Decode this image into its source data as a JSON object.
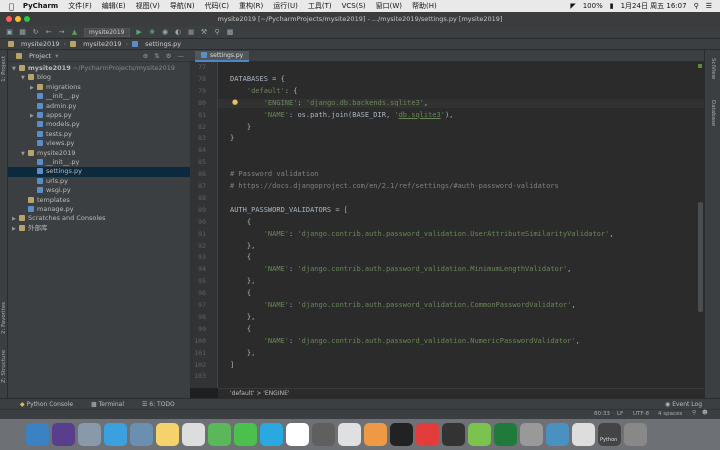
{
  "menubar": {
    "apple": "",
    "app_name": "PyCharm",
    "items": [
      "文件(F)",
      "编辑(E)",
      "视图(V)",
      "导航(N)",
      "代码(C)",
      "重构(R)",
      "运行(U)",
      "工具(T)",
      "VCS(S)",
      "窗口(W)",
      "帮助(H)"
    ],
    "battery": "100%",
    "datetime": "1月24日 周五  16:07"
  },
  "window": {
    "title": "mysite2019 [~/PycharmProjects/mysite2019] - .../mysite2019/settings.py [mysite2019]"
  },
  "toolbar": {
    "run_config": "mysite2019"
  },
  "navbar": {
    "crumbs": [
      "mysite2019",
      "mysite2019",
      "settings.py"
    ]
  },
  "project_panel": {
    "header": "Project",
    "tree": [
      {
        "label": "mysite2019",
        "extra": "~/PycharmProjects/mysite2019",
        "depth": 0,
        "kind": "folder",
        "open": true
      },
      {
        "label": "blog",
        "depth": 1,
        "kind": "folder",
        "open": true
      },
      {
        "label": "migrations",
        "depth": 2,
        "kind": "folder",
        "open": false
      },
      {
        "label": "__init__.py",
        "depth": 2,
        "kind": "py"
      },
      {
        "label": "admin.py",
        "depth": 2,
        "kind": "py"
      },
      {
        "label": "apps.py",
        "depth": 2,
        "kind": "py",
        "closed": true
      },
      {
        "label": "models.py",
        "depth": 2,
        "kind": "py"
      },
      {
        "label": "tests.py",
        "depth": 2,
        "kind": "py"
      },
      {
        "label": "views.py",
        "depth": 2,
        "kind": "py"
      },
      {
        "label": "mysite2019",
        "depth": 1,
        "kind": "folder",
        "open": true
      },
      {
        "label": "__init__.py",
        "depth": 2,
        "kind": "py"
      },
      {
        "label": "settings.py",
        "depth": 2,
        "kind": "py",
        "selected": true
      },
      {
        "label": "urls.py",
        "depth": 2,
        "kind": "py"
      },
      {
        "label": "wsgi.py",
        "depth": 2,
        "kind": "py"
      },
      {
        "label": "templates",
        "depth": 1,
        "kind": "folder"
      },
      {
        "label": "manage.py",
        "depth": 1,
        "kind": "py"
      },
      {
        "label": "Scratches and Consoles",
        "depth": 0,
        "kind": "folder",
        "open": false
      },
      {
        "label": "外部库",
        "depth": 0,
        "kind": "folder",
        "open": false
      }
    ]
  },
  "editor": {
    "tab": "settings.py",
    "lines": [
      {
        "n": "77",
        "html": ""
      },
      {
        "n": "78",
        "html": "<span class='var'>DATABASES</span> = {"
      },
      {
        "n": "79",
        "html": "    <span class='str'>'default'</span>: {"
      },
      {
        "n": "80",
        "html": "        <span class='str'>'ENGINE'</span>: <span class='str'>'django.db.backends.sqlite3'</span>,"
      },
      {
        "n": "81",
        "html": "        <span class='str'>'NAME'</span>: os.path.join(BASE_DIR, <span class='str'>'<u>db.sqlite3</u>'</span>),"
      },
      {
        "n": "82",
        "html": "    }"
      },
      {
        "n": "83",
        "html": "}"
      },
      {
        "n": "84",
        "html": ""
      },
      {
        "n": "85",
        "html": ""
      },
      {
        "n": "86",
        "html": "<span class='cmt'># Password validation</span>"
      },
      {
        "n": "87",
        "html": "<span class='cmt'># https://docs.djangoproject.com/en/2.1/ref/settings/#auth-password-validators</span>"
      },
      {
        "n": "88",
        "html": ""
      },
      {
        "n": "89",
        "html": "<span class='var'>AUTH_PASSWORD_VALIDATORS</span> = ["
      },
      {
        "n": "90",
        "html": "    {"
      },
      {
        "n": "91",
        "html": "        <span class='str'>'NAME'</span>: <span class='str'>'django.contrib.auth.password_validation.UserAttributeSimilarityValidator'</span>,"
      },
      {
        "n": "92",
        "html": "    },"
      },
      {
        "n": "93",
        "html": "    {"
      },
      {
        "n": "94",
        "html": "        <span class='str'>'NAME'</span>: <span class='str'>'django.contrib.auth.password_validation.MinimumLengthValidator'</span>,"
      },
      {
        "n": "95",
        "html": "    },"
      },
      {
        "n": "96",
        "html": "    {"
      },
      {
        "n": "97",
        "html": "        <span class='str'>'NAME'</span>: <span class='str'>'django.contrib.auth.password_validation.CommonPasswordValidator'</span>,"
      },
      {
        "n": "98",
        "html": "    },"
      },
      {
        "n": "99",
        "html": "    {"
      },
      {
        "n": "100",
        "html": "        <span class='str'>'NAME'</span>: <span class='str'>'django.contrib.auth.password_validation.NumericPasswordValidator'</span>,"
      },
      {
        "n": "101",
        "html": "    },"
      },
      {
        "n": "102",
        "html": "]"
      },
      {
        "n": "103",
        "html": ""
      }
    ],
    "breadcrumb": "'default'  >  'ENGINE'"
  },
  "left_strip": {
    "project": "1: Project",
    "favorites": "2: Favorites",
    "structure": "Z: Structure"
  },
  "right_strip": {
    "scitview": "SciView",
    "database": "Database"
  },
  "toolwindows": {
    "python_console": "Python Console",
    "terminal": "Terminal",
    "todo": "6: TODO",
    "event_log": "Event Log"
  },
  "status": {
    "position": "80:33",
    "line_sep": "LF",
    "encoding": "UTF-8",
    "indent": "4 spaces"
  },
  "dock": {
    "python_label": "Python",
    "icon_colors": [
      "#3b82c4",
      "#5a3e8e",
      "#8899aa",
      "#3aa0e0",
      "#6a8fb0",
      "#f4d36b",
      "#dddddd",
      "#5ab85a",
      "#4cc04c",
      "#2aa8e0",
      "#ffffff",
      "#5f5f5f",
      "#e0e0e0",
      "#ee9944",
      "#222222",
      "#e23c3c",
      "#333333",
      "#7cc24e",
      "#1f7a3c",
      "#999999",
      "#4a90c0",
      "#dddddd",
      "#444444",
      "#888888"
    ]
  }
}
